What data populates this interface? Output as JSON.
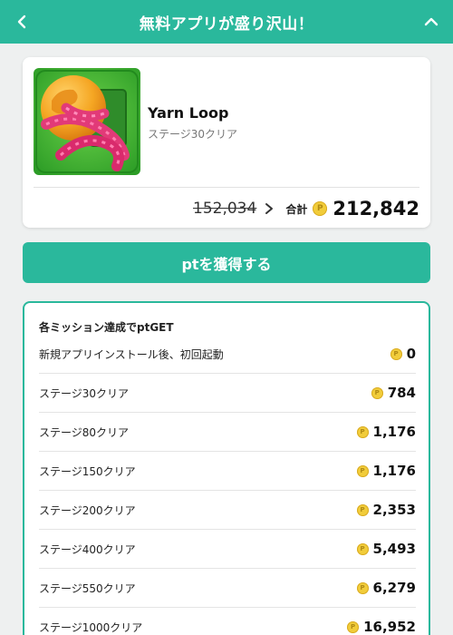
{
  "header": {
    "title": "無料アプリが盛り沢山！"
  },
  "app": {
    "name": "Yarn Loop",
    "subtitle": "ステージ30クリア",
    "old_points": "152,034",
    "total_label": "合計",
    "total_points": "212,842"
  },
  "cta": {
    "label": "ptを獲得する"
  },
  "missions": {
    "title": "各ミッション達成でptGET",
    "items": [
      {
        "label": "新規アプリインストール後、初回起動",
        "points": "0"
      },
      {
        "label": "ステージ30クリア",
        "points": "784"
      },
      {
        "label": "ステージ80クリア",
        "points": "1,176"
      },
      {
        "label": "ステージ150クリア",
        "points": "1,176"
      },
      {
        "label": "ステージ200クリア",
        "points": "2,353"
      },
      {
        "label": "ステージ400クリア",
        "points": "5,493"
      },
      {
        "label": "ステージ550クリア",
        "points": "6,279"
      },
      {
        "label": "ステージ1000クリア",
        "points": "16,952"
      }
    ]
  },
  "colors": {
    "accent": "#2ab89c",
    "coin": "#f1cc3a"
  },
  "icons": {
    "back": "chevron-left-icon",
    "collapse": "chevron-up-icon",
    "arrow": "chevron-right-icon",
    "coin": "coin-icon"
  }
}
